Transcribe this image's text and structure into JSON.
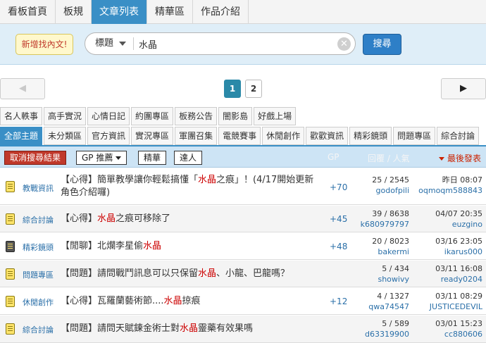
{
  "nav": {
    "tabs": [
      {
        "label": "看板首頁"
      },
      {
        "label": "板規"
      },
      {
        "label": "文章列表"
      },
      {
        "label": "精華區"
      },
      {
        "label": "作品介紹"
      }
    ],
    "active_tab": 2
  },
  "search": {
    "new_label": "新增找內文!",
    "type_label": "標題",
    "query": "水晶",
    "button_label": "搜尋"
  },
  "pager": {
    "prev": "◀",
    "next": "▶",
    "pages": [
      "1",
      "2"
    ],
    "current": 1
  },
  "categories_top": [
    "名人軼事",
    "高手實況",
    "心情日記",
    "約團專區",
    "板務公告",
    "闇影島",
    "好戲上場"
  ],
  "categories_bottom": [
    "全部主題",
    "未分類區",
    "官方資訊",
    "實況專區",
    "軍團召集",
    "電競賽事",
    "休閒創作",
    "歡歡資訊",
    "精彩鏡頭",
    "問題專區",
    "綜合討論"
  ],
  "filter": {
    "cancel_label": "取消搜尋結果",
    "gp_label": "GP 推薦",
    "essence_label": "精華",
    "expert_label": "達人",
    "col_gp": "GP",
    "col_reply": "回覆 / 人氣",
    "col_last": "最後發表"
  },
  "posts": [
    {
      "category": "教戰資訊",
      "title_pre": "【心得】簡單教學讓你輕鬆搞懂「",
      "title_hl": "水晶",
      "title_post": "之痕」！(4/17開始更新角色介紹囉)",
      "gp": "+70",
      "stats": "25 / 2545",
      "author": "godofpili",
      "last_time": "昨日 08:07",
      "last_user": "oqmoqm588843",
      "icon": "yellow"
    },
    {
      "category": "綜合討論",
      "title_pre": "【心得】",
      "title_hl": "水晶",
      "title_post": "之痕可移除了",
      "gp": "+45",
      "stats": "39 / 8638",
      "author": "k680979797",
      "last_time": "04/07 20:35",
      "last_user": "euzgino",
      "icon": "yellow"
    },
    {
      "category": "精彩鏡頭",
      "title_pre": "【閒聊】北爛李星偷",
      "title_hl": "水晶",
      "title_post": "",
      "gp": "+48",
      "stats": "20 / 8023",
      "author": "bakermi",
      "last_time": "03/16 23:05",
      "last_user": "ikarus000",
      "icon": "dark"
    },
    {
      "category": "問題專區",
      "title_pre": "【問題】請問戰鬥訊息可以只保留",
      "title_hl": "水晶",
      "title_post": "、小龍、巴龍嗎？",
      "gp": "",
      "stats": "5 / 434",
      "author": "showivy",
      "last_time": "03/11 16:08",
      "last_user": "ready0204",
      "icon": "yellow"
    },
    {
      "category": "休閒創作",
      "title_pre": "【心得】瓦羅蘭藝術節....",
      "title_hl": "水晶",
      "title_post": "掠痕",
      "gp": "+12",
      "stats": "4 / 1327",
      "author": "qwa74547",
      "last_time": "03/11 08:29",
      "last_user": "JUSTICEDEVIL",
      "icon": "yellow"
    },
    {
      "category": "綜合討論",
      "title_pre": "【問題】請問天賦鍊金術士對",
      "title_hl": "水晶",
      "title_post": "靈藥有效果嗎",
      "gp": "",
      "stats": "5 / 589",
      "author": "d63319900",
      "last_time": "03/01 15:23",
      "last_user": "cc880606",
      "icon": "yellow"
    }
  ],
  "colors": {
    "accent": "#3a8fc6",
    "highlight": "#cc0000",
    "link": "#2a6fa8"
  }
}
